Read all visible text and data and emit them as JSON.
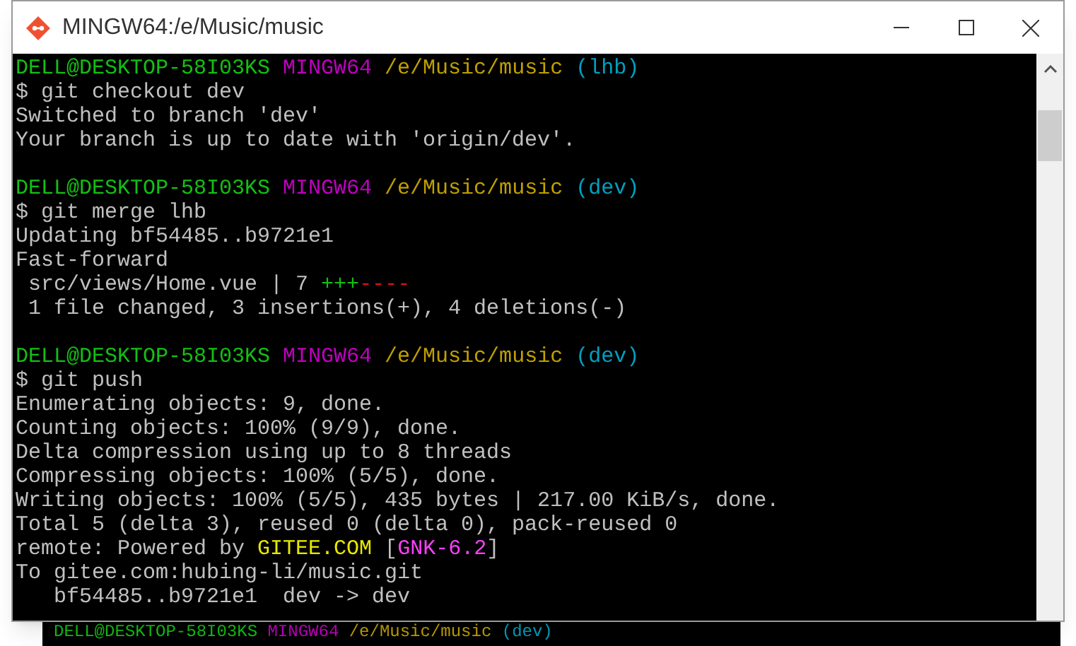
{
  "window": {
    "title": "MINGW64:/e/Music/music"
  },
  "terminal": {
    "lines": [
      {
        "kind": "text",
        "segments": [
          {
            "text": "DELL@DESKTOP-58I03KS",
            "color": "#13c013"
          },
          {
            "text": " MINGW64",
            "color": "#c000c0"
          },
          {
            "text": " /e/Music/music",
            "color": "#c0a000"
          },
          {
            "text": " (lhb)",
            "color": "#00a0c0"
          }
        ]
      },
      {
        "kind": "text",
        "segments": [
          {
            "text": "$ git checkout dev",
            "color": "#c0c0c0"
          }
        ]
      },
      {
        "kind": "text",
        "segments": [
          {
            "text": "Switched to branch 'dev'",
            "color": "#c0c0c0"
          }
        ]
      },
      {
        "kind": "text",
        "segments": [
          {
            "text": "Your branch is up to date with 'origin/dev'.",
            "color": "#c0c0c0"
          }
        ]
      },
      {
        "kind": "blank"
      },
      {
        "kind": "text",
        "segments": [
          {
            "text": "DELL@DESKTOP-58I03KS",
            "color": "#13c013"
          },
          {
            "text": " MINGW64",
            "color": "#c000c0"
          },
          {
            "text": " /e/Music/music",
            "color": "#c0a000"
          },
          {
            "text": " (dev)",
            "color": "#00a0c0"
          }
        ]
      },
      {
        "kind": "text",
        "segments": [
          {
            "text": "$ git merge lhb",
            "color": "#c0c0c0"
          }
        ]
      },
      {
        "kind": "text",
        "segments": [
          {
            "text": "Updating bf54485..b9721e1",
            "color": "#c0c0c0"
          }
        ]
      },
      {
        "kind": "text",
        "segments": [
          {
            "text": "Fast-forward",
            "color": "#c0c0c0"
          }
        ]
      },
      {
        "kind": "text",
        "segments": [
          {
            "text": " src/views/Home.vue | 7 ",
            "color": "#c0c0c0"
          },
          {
            "text": "+++",
            "color": "#13c013"
          },
          {
            "text": "----",
            "color": "#e01010"
          }
        ]
      },
      {
        "kind": "text",
        "segments": [
          {
            "text": " 1 file changed, 3 insertions(+), 4 deletions(-)",
            "color": "#c0c0c0"
          }
        ]
      },
      {
        "kind": "blank"
      },
      {
        "kind": "text",
        "segments": [
          {
            "text": "DELL@DESKTOP-58I03KS",
            "color": "#13c013"
          },
          {
            "text": " MINGW64",
            "color": "#c000c0"
          },
          {
            "text": " /e/Music/music",
            "color": "#c0a000"
          },
          {
            "text": " (dev)",
            "color": "#00a0c0"
          }
        ]
      },
      {
        "kind": "text",
        "segments": [
          {
            "text": "$ git push",
            "color": "#c0c0c0"
          }
        ]
      },
      {
        "kind": "text",
        "segments": [
          {
            "text": "Enumerating objects: 9, done.",
            "color": "#c0c0c0"
          }
        ]
      },
      {
        "kind": "text",
        "segments": [
          {
            "text": "Counting objects: 100% (9/9), done.",
            "color": "#c0c0c0"
          }
        ]
      },
      {
        "kind": "text",
        "segments": [
          {
            "text": "Delta compression using up to 8 threads",
            "color": "#c0c0c0"
          }
        ]
      },
      {
        "kind": "text",
        "segments": [
          {
            "text": "Compressing objects: 100% (5/5), done.",
            "color": "#c0c0c0"
          }
        ]
      },
      {
        "kind": "text",
        "segments": [
          {
            "text": "Writing objects: 100% (5/5), 435 bytes | 217.00 KiB/s, done.",
            "color": "#c0c0c0"
          }
        ]
      },
      {
        "kind": "text",
        "segments": [
          {
            "text": "Total 5 (delta 3), reused 0 (delta 0), pack-reused 0",
            "color": "#c0c0c0"
          }
        ]
      },
      {
        "kind": "text",
        "segments": [
          {
            "text": "remote: Powered by ",
            "color": "#c0c0c0"
          },
          {
            "text": "GITEE.COM",
            "color": "#e8e800"
          },
          {
            "text": " [",
            "color": "#c0c0c0"
          },
          {
            "text": "GNK-6.2",
            "color": "#ff40ff"
          },
          {
            "text": "]",
            "color": "#c0c0c0"
          }
        ]
      },
      {
        "kind": "text",
        "segments": [
          {
            "text": "To gitee.com:hubing-li/music.git",
            "color": "#c0c0c0"
          }
        ]
      },
      {
        "kind": "text",
        "segments": [
          {
            "text": "   bf54485..b9721e1  dev -> dev",
            "color": "#c0c0c0"
          }
        ]
      }
    ]
  },
  "background_window": {
    "line": [
      {
        "text": "DELL@DESKTOP-58I03KS",
        "color": "#13c013"
      },
      {
        "text": " MINGW64",
        "color": "#c000c0"
      },
      {
        "text": " /e/Music/music",
        "color": "#c0a000"
      },
      {
        "text": " (dev)",
        "color": "#00a0c0"
      }
    ]
  }
}
